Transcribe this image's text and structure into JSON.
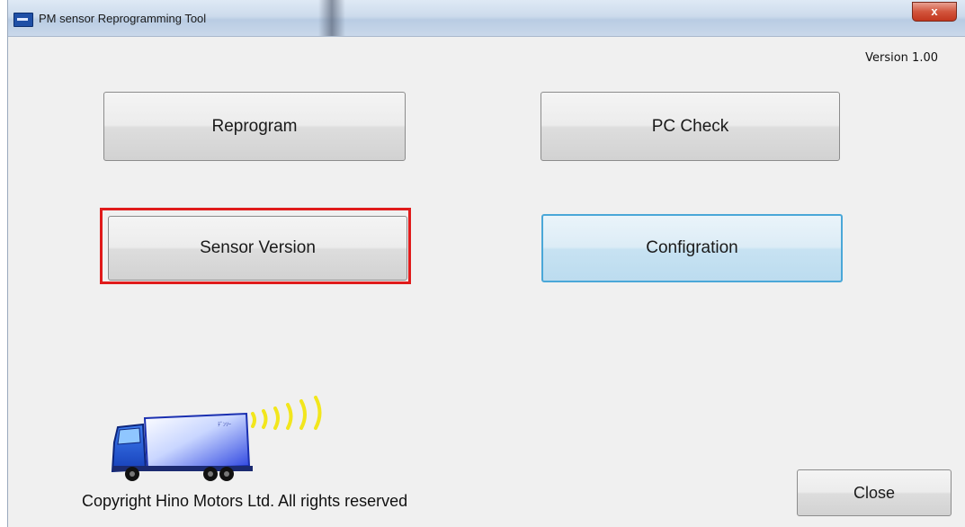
{
  "window": {
    "title": "PM sensor Reprogramming Tool",
    "close_glyph": "x",
    "version_label": "Version 1.00"
  },
  "buttons": {
    "reprogram": "Reprogram",
    "pc_check": "PC Check",
    "sensor_version": "Sensor Version",
    "configuration": "Configration",
    "close": "Close"
  },
  "footer": {
    "copyright": "Copyright Hino Motors Ltd. All rights reserved"
  },
  "colors": {
    "highlight": "#e01b1b",
    "focus_border": "#4aa7d8",
    "truck_cab": "#1e4fd8",
    "signal_waves": "#f2e61c"
  },
  "icons": {
    "app": "app-icon",
    "truck": "truck-illustration"
  }
}
